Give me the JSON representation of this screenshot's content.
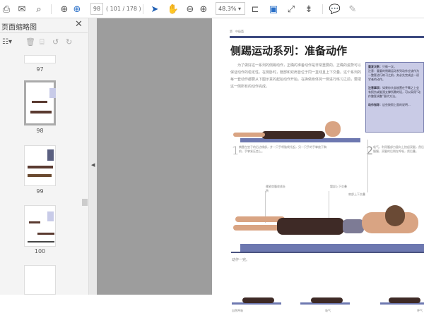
{
  "toolbar": {
    "page_input": "98",
    "page_count": "( 101 / 178 )",
    "zoom": "48.3%"
  },
  "sidebar": {
    "title": "页面缩略图",
    "thumbnails": [
      {
        "label": "97"
      },
      {
        "label": "98"
      },
      {
        "label": "99"
      },
      {
        "label": "100"
      }
    ]
  },
  "document": {
    "header": "第　中级篇",
    "title": "侧踢运动系列：准备动作",
    "intro": "为了做好这一系列的侧踢动作，正确的准备动作是非常重要的。正确的姿势可以保证动作的稳定性。在侧卧时，髋部和双肩皆位于同一直线且上下交叠。这个系列的每一套动作都要从下图示意的起始动作开始。在换做身体另一侧进行练习之前，要把这一侧所有的动作完成。",
    "box_repeat_label": "重复次数：",
    "box_repeat": "只做一次。",
    "box_note": "注意：重要的侧踢运动系列动作应该作为一整套进行练习之前，务必先完成这一初学者的动作。",
    "box_caution_label": "注意事项：",
    "box_caution": "如果你头部放置在手臂之上会有损伤或脑颈支撑所需的话，可以采用“动作整套调整”替代方法。",
    "box_motion_label": "动作指导：",
    "box_motion": "这些按照上面的说明...",
    "step1_num": "1",
    "step1": "躺靠在垫子的后边缘部，并一只手将脑袋托起，另一只手的手掌放于胸前，手掌紧压垫上。",
    "step2_num": "2",
    "step2": "吸气，利用腹部力量向上抬起双腿，然后慢慢，双腿的后侧在呼吸，然后叠。",
    "label_a": "绷紧穿腹收紧肚脐",
    "label_b": "髋部上下交叠",
    "label_c": "肩部上下交叠",
    "end_text": "动作一完。",
    "bottom_labels": [
      "自然呼吸",
      "吸气",
      "呼气"
    ]
  }
}
